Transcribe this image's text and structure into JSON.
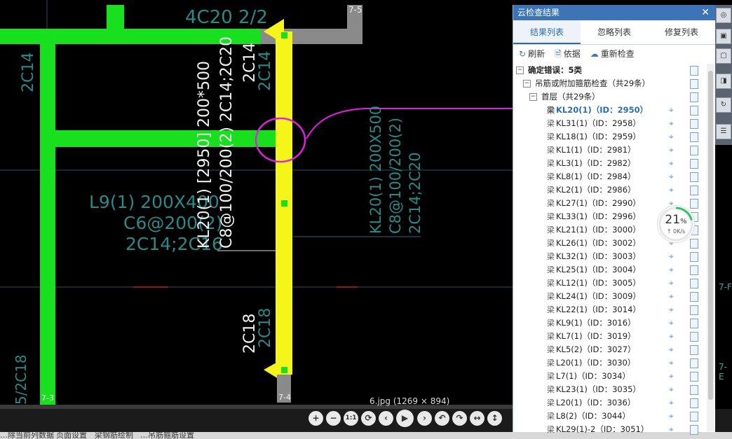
{
  "drawing": {
    "top_rebar": "4C20 2/2",
    "axis_top_right": "7-5",
    "left_col_note": "2C14",
    "left_bottom_note": "5/2C18",
    "axis_bottom_left": "7-3",
    "axis_bottom_mid": "7-4",
    "l9_line1": "L9(1) 200X400",
    "l9_line2": "C6@200(2)",
    "l9_line3": "2C14;2C16",
    "kl20_line1": "KL20(1) [2950] 200*500",
    "kl20_line2": "C8@100/200(2) 2C14;2C20",
    "kl20_top_rebar": "2C14",
    "kl20_top_rebar_ghost": "2C14",
    "kl20_bottom_rebar": "2C18",
    "kl20_bottom_rebar_ghost": "2C18",
    "right_line1": "KL20(1) 200X500",
    "right_line2": "C8@100/200(2)",
    "right_line3": "2C14;2C20",
    "edge_tag_1": "7-F",
    "edge_tag_2": "7-E"
  },
  "viewer": {
    "caption": "6.jpg (1269 × 894)",
    "buttons": [
      "+",
      "−",
      "1:1",
      "⟳",
      "‹",
      "▶",
      "›",
      "↶",
      "↷",
      "↔",
      "↕"
    ]
  },
  "status": {
    "items": [
      "…除当前列数据",
      "页面设置",
      "梁钢筋绘制",
      "…吊筋箍筋设置"
    ]
  },
  "panel": {
    "title": "云检查结果",
    "close": "✕",
    "tabs": [
      "结果列表",
      "忽略列表",
      "修复列表"
    ],
    "toolbar": {
      "refresh": "刷新",
      "basis": "依据",
      "recheck": "重新检查"
    },
    "category": "确定错误：5类",
    "group": "吊筋或附加箍筋检查（共29条）",
    "floor": "首层（共29条）",
    "items": [
      "KL20(1)（ID：2950）",
      "KL31(1)（ID：2958）",
      "KL18(1)（ID：2959）",
      "KL1(1)（ID：2981）",
      "KL3(1)（ID：2982）",
      "KL8(1)（ID：2984）",
      "KL2(1)（ID：2986）",
      "KL27(1)（ID：2990）",
      "KL33(1)（ID：2996）",
      "KL21(1)（ID：3000）",
      "KL26(1)（ID：3002）",
      "KL32(1)（ID：3003）",
      "KL25(1)（ID：3004）",
      "KL12(1)（ID：3005）",
      "KL24(1)（ID：3009）",
      "KL22(1)（ID：3014）",
      "KL9(1)（ID：3016）",
      "KL7(1)（ID：3019）",
      "KL5(2)（ID：3027）",
      "L20(1)（ID：3030）",
      "L7(1)（ID：3034）",
      "KL23(1)（ID：3035）",
      "L20(1)（ID：3036）",
      "L8(2)（ID：3044）",
      "KL29(1)-2（ID：3051）"
    ],
    "beam_prefix": "梁",
    "selected_index": 0
  },
  "progress": {
    "percent": "21",
    "unit": "%",
    "speed": "↑ 0K/s",
    "fraction": 0.21
  },
  "colors": {
    "beam_green": "#19e01e",
    "beam_yellow": "#f5f51a",
    "annotation_magenta": "#e020e0",
    "panel_blue": "#3c74b6"
  }
}
